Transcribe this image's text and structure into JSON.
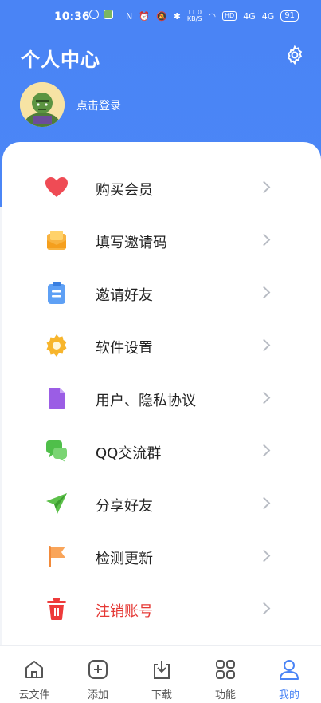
{
  "status": {
    "time": "10:36",
    "net_speed": "11.0",
    "net_unit": "KB/S",
    "hd": "HD",
    "sig1": "4G",
    "sig2": "4G",
    "battery": "91"
  },
  "header": {
    "title": "个人中心",
    "login_text": "点击登录"
  },
  "colors": {
    "brand": "#4a84f5",
    "danger": "#e53935"
  },
  "menu": [
    {
      "label": "购买会员",
      "icon": "heart-icon"
    },
    {
      "label": "填写邀请码",
      "icon": "mail-icon"
    },
    {
      "label": "邀请好友",
      "icon": "clipboard-icon"
    },
    {
      "label": "软件设置",
      "icon": "gear-icon"
    },
    {
      "label": "用户、隐私协议",
      "icon": "document-icon"
    },
    {
      "label": "QQ交流群",
      "icon": "chat-icon"
    },
    {
      "label": "分享好友",
      "icon": "send-icon"
    },
    {
      "label": "检测更新",
      "icon": "flag-icon"
    },
    {
      "label": "注销账号",
      "icon": "trash-icon"
    }
  ],
  "tabs": [
    {
      "label": "云文件",
      "icon": "house-icon"
    },
    {
      "label": "添加",
      "icon": "plus-icon"
    },
    {
      "label": "下载",
      "icon": "download-icon"
    },
    {
      "label": "功能",
      "icon": "grid-icon"
    },
    {
      "label": "我的",
      "icon": "person-icon",
      "active": true
    }
  ]
}
